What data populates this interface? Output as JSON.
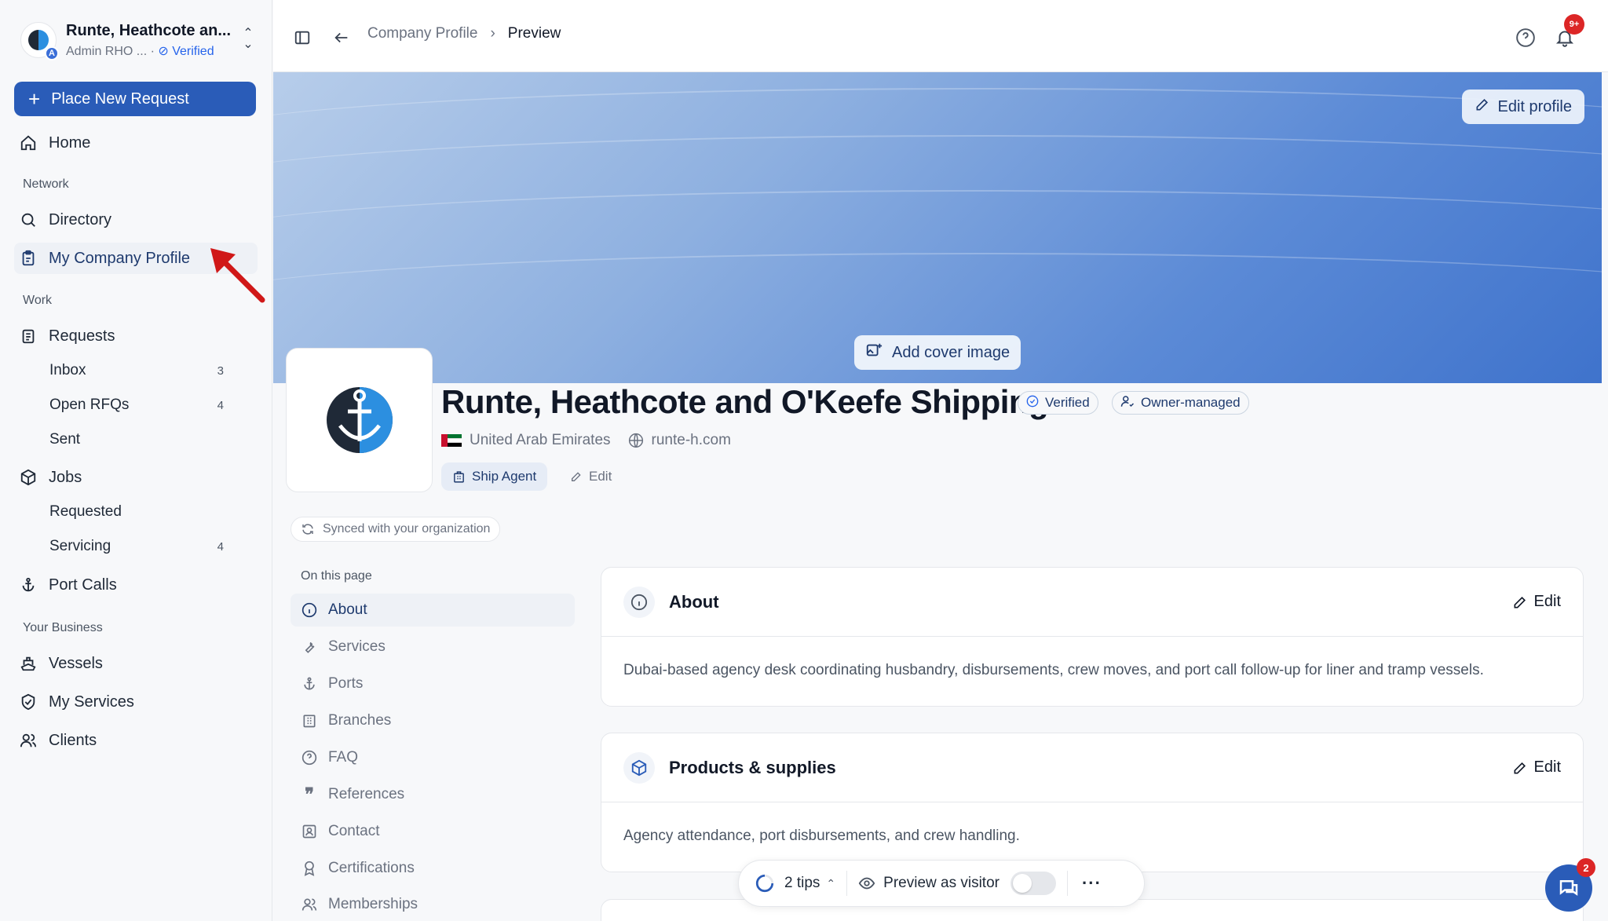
{
  "org": {
    "name": "Runte, Heathcote an...",
    "role": "Admin RHO ...",
    "verified": "Verified",
    "avatar_letter": "A"
  },
  "sidebar": {
    "cta": "Place New Request",
    "home": "Home",
    "sections": {
      "network": "Network",
      "work": "Work",
      "business": "Your Business"
    },
    "directory": "Directory",
    "my_company_profile": "My Company Profile",
    "requests": "Requests",
    "inbox": {
      "label": "Inbox",
      "count": "3"
    },
    "open_rfqs": {
      "label": "Open RFQs",
      "count": "4"
    },
    "sent": "Sent",
    "jobs": "Jobs",
    "requested": "Requested",
    "servicing": {
      "label": "Servicing",
      "count": "4"
    },
    "port_calls": "Port Calls",
    "vessels": "Vessels",
    "my_services": "My Services",
    "clients": "Clients"
  },
  "header": {
    "crumb_parent": "Company Profile",
    "crumb_current": "Preview",
    "notif_badge": "9+"
  },
  "cover": {
    "edit_profile": "Edit profile",
    "add_cover": "Add cover image"
  },
  "company": {
    "name": "Runte, Heathcote and O'Keefe Shipping",
    "verified": "Verified",
    "owner": "Owner-managed",
    "country": "United Arab Emirates",
    "website": "runte-h.com",
    "role": "Ship Agent",
    "edit": "Edit",
    "synced": "Synced with your organization"
  },
  "on_this_page": {
    "label": "On this page",
    "items": [
      "About",
      "Services",
      "Ports",
      "Branches",
      "FAQ",
      "References",
      "Contact",
      "Certifications",
      "Memberships"
    ]
  },
  "cards": {
    "about": {
      "title": "About",
      "edit": "Edit",
      "body": "Dubai-based agency desk coordinating husbandry, disbursements, crew moves, and port call follow-up for liner and tramp vessels."
    },
    "products": {
      "title": "Products & supplies",
      "edit": "Edit",
      "body": "Agency attendance, port disbursements, and crew handling."
    }
  },
  "bottom_bar": {
    "tips": "2 tips",
    "preview": "Preview as visitor",
    "preview_on": false
  },
  "chat": {
    "badge": "2"
  },
  "colors": {
    "primary": "#2a5cb8",
    "badge": "#dc2626",
    "verified": "#2563eb"
  }
}
